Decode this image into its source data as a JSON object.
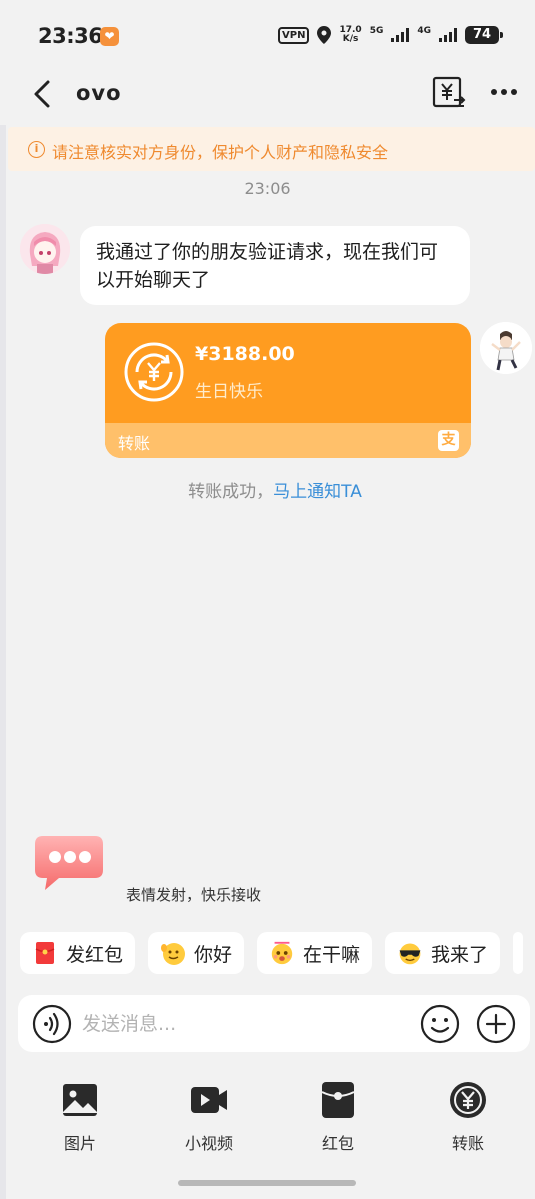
{
  "status_bar": {
    "time": "23:36",
    "vpn": "VPN",
    "speed_top": "17.0",
    "speed_bottom": "K/s",
    "net_5g": "5G",
    "net_4g": "4G",
    "battery": "74"
  },
  "header": {
    "title": "ovo"
  },
  "notice": {
    "text": "请注意核实对方身份，保护个人财产和隐私安全"
  },
  "chat": {
    "timestamp": "23:06",
    "incoming_message": "我通过了你的朋友验证请求，现在我们可以开始聊天了",
    "transfer": {
      "amount": "¥3188.00",
      "memo": "生日快乐",
      "label": "转账",
      "alipay_glyph": "支"
    },
    "transfer_status": "转账成功，",
    "transfer_notify_link": "马上通知TA"
  },
  "emoji_promo": {
    "text": "表情发射，快乐接收"
  },
  "quick_replies": [
    {
      "label": "发红包",
      "icon": "red-envelope-icon"
    },
    {
      "label": "你好",
      "icon": "wave-emoji-icon"
    },
    {
      "label": "在干嘛",
      "icon": "curious-emoji-icon"
    },
    {
      "label": "我来了",
      "icon": "sunglasses-emoji-icon"
    }
  ],
  "input": {
    "placeholder": "发送消息..."
  },
  "toolbar": {
    "photo": "图片",
    "video": "小视频",
    "red_packet": "红包",
    "transfer": "转账"
  },
  "colors": {
    "accent_orange": "#ff9c20",
    "notice_text": "#ef8a2f",
    "link_blue": "#3a8fd8",
    "background": "#f2f2f2"
  }
}
